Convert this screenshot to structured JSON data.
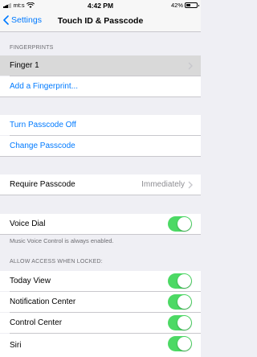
{
  "status": {
    "carrier": "mt:s",
    "time": "4:42 PM",
    "battery_percent": "42%",
    "battery_level": 0.42
  },
  "nav": {
    "back_label": "Settings",
    "title": "Touch ID & Passcode"
  },
  "fingerprints": {
    "header": "FINGERPRINTS",
    "finger_1": "Finger 1",
    "add": "Add a Fingerprint..."
  },
  "passcode": {
    "turn_off": "Turn Passcode Off",
    "change": "Change Passcode"
  },
  "require": {
    "label": "Require Passcode",
    "value": "Immediately"
  },
  "voice_dial": {
    "label": "Voice Dial",
    "on": true,
    "footer": "Music Voice Control is always enabled."
  },
  "locked": {
    "header": "ALLOW ACCESS WHEN LOCKED:",
    "items": [
      {
        "label": "Today View",
        "on": true
      },
      {
        "label": "Notification Center",
        "on": true
      },
      {
        "label": "Control Center",
        "on": true
      },
      {
        "label": "Siri",
        "on": true
      }
    ]
  },
  "colors": {
    "accent": "#007aff",
    "toggle_on": "#4cd964",
    "background": "#efeff4"
  }
}
